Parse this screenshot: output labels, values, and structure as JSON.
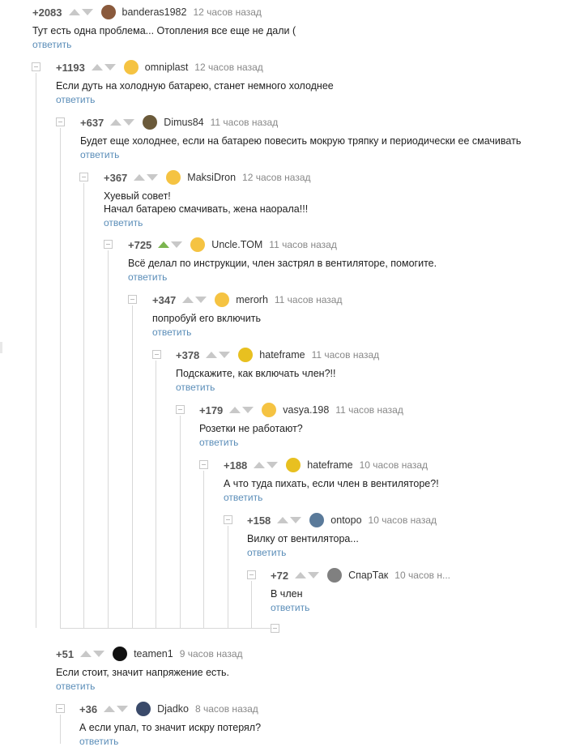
{
  "comments": [
    {
      "rating": "+2083",
      "user": "banderas1982",
      "time": "12 часов назад",
      "text": [
        "Тут есть одна проблема... Отопления все еще не дали ("
      ],
      "reply": "ответить",
      "avatar_color": "#8a5a3c",
      "up_active": false
    },
    {
      "rating": "+1193",
      "user": "omniplast",
      "time": "12 часов назад",
      "text": [
        "Если дуть на холодную батарею, станет немного холоднее"
      ],
      "reply": "ответить",
      "avatar_color": "#f5c342",
      "up_active": false
    },
    {
      "rating": "+637",
      "user": "Dimus84",
      "time": "11 часов назад",
      "text": [
        "Будет еще холоднее, если на батарею повесить мокрую тряпку и периодически ее смачивать"
      ],
      "reply": "ответить",
      "avatar_color": "#6b5a3a",
      "up_active": false
    },
    {
      "rating": "+367",
      "user": "MaksiDron",
      "time": "12 часов назад",
      "text": [
        "Хуевый совет!",
        "Начал батарею смачивать, жена наорала!!!"
      ],
      "reply": "ответить",
      "avatar_color": "#f5c342",
      "up_active": false
    },
    {
      "rating": "+725",
      "user": "Uncle.TOM",
      "time": "11 часов назад",
      "text": [
        "Всё делал по инструкции, член застрял в вентиляторе, помогите."
      ],
      "reply": "ответить",
      "avatar_color": "#f5c342",
      "up_active": true
    },
    {
      "rating": "+347",
      "user": "merorh",
      "time": "11 часов назад",
      "text": [
        "попробуй его включить"
      ],
      "reply": "ответить",
      "avatar_color": "#f5c342",
      "up_active": false
    },
    {
      "rating": "+378",
      "user": "hateframe",
      "time": "11 часов назад",
      "text": [
        "Подскажите, как включать член?!!"
      ],
      "reply": "ответить",
      "avatar_color": "#e8c020",
      "up_active": false
    },
    {
      "rating": "+179",
      "user": "vasya.198",
      "time": "11 часов назад",
      "text": [
        "Розетки не работают?"
      ],
      "reply": "ответить",
      "avatar_color": "#f5c342",
      "up_active": false
    },
    {
      "rating": "+188",
      "user": "hateframe",
      "time": "10 часов назад",
      "text": [
        "А что туда пихать, если член в вентиляторе?!"
      ],
      "reply": "ответить",
      "avatar_color": "#e8c020",
      "up_active": false
    },
    {
      "rating": "+158",
      "user": "ontopo",
      "time": "10 часов назад",
      "text": [
        "Вилку от вентилятора..."
      ],
      "reply": "ответить",
      "avatar_color": "#5a7a9a",
      "up_active": false
    },
    {
      "rating": "+72",
      "user": "СпарТак",
      "time": "10 часов н...",
      "text": [
        "В член"
      ],
      "reply": "ответить",
      "avatar_color": "#808080",
      "up_active": false
    },
    {
      "rating": "+51",
      "user": "teamen1",
      "time": "9 часов назад",
      "text": [
        "Если стоит, значит напряжение есть."
      ],
      "reply": "ответить",
      "avatar_color": "#111111",
      "up_active": false
    },
    {
      "rating": "+36",
      "user": "Djadko",
      "time": "8 часов назад",
      "text": [
        "А если упал, то значит искру потерял?"
      ],
      "reply": "ответить",
      "avatar_color": "#3a4a6a",
      "up_active": false
    }
  ]
}
